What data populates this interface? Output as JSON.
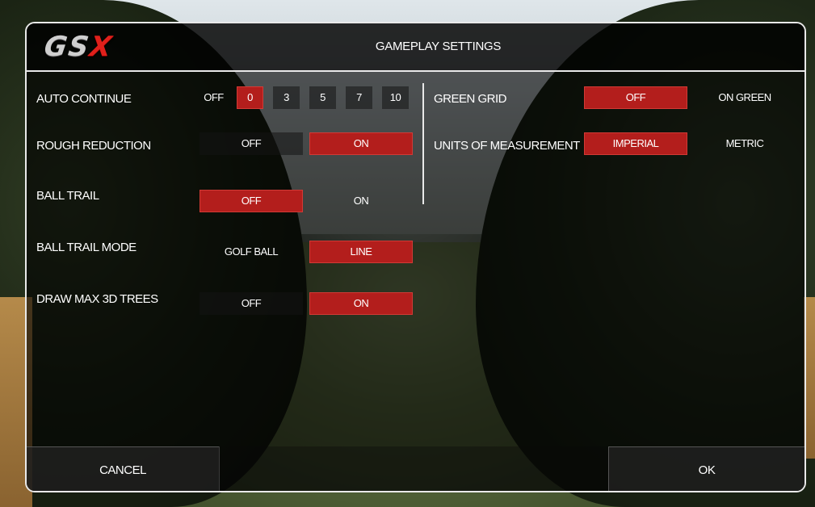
{
  "header": {
    "logo_text": "GS",
    "logo_accent": "X",
    "title": "GAMEPLAY SETTINGS"
  },
  "colors": {
    "selected": "#b31e1c",
    "frame": "#e9e9e9",
    "logo_accent": "#e0201b"
  },
  "settings": {
    "auto_continue": {
      "label": "AUTO CONTINUE",
      "options": [
        "OFF",
        "0",
        "3",
        "5",
        "7",
        "10"
      ],
      "selected": "0"
    },
    "rough_reduction": {
      "label": "ROUGH REDUCTION",
      "options": [
        "OFF",
        "ON"
      ],
      "selected": "ON"
    },
    "ball_trail": {
      "label": "BALL TRAIL",
      "options": [
        "OFF",
        "ON"
      ],
      "selected": "OFF"
    },
    "ball_trail_mode": {
      "label": "BALL TRAIL MODE",
      "options": [
        "GOLF BALL",
        "LINE"
      ],
      "selected": "LINE"
    },
    "draw_max_3d_trees": {
      "label": "DRAW MAX 3D TREES",
      "options": [
        "OFF",
        "ON"
      ],
      "selected": "ON"
    },
    "green_grid": {
      "label": "GREEN GRID",
      "options": [
        "OFF",
        "ON GREEN"
      ],
      "selected": "OFF"
    },
    "units": {
      "label": "UNITS OF MEASUREMENT",
      "options": [
        "IMPERIAL",
        "METRIC"
      ],
      "selected": "IMPERIAL"
    }
  },
  "footer": {
    "cancel": "CANCEL",
    "ok": "OK"
  }
}
